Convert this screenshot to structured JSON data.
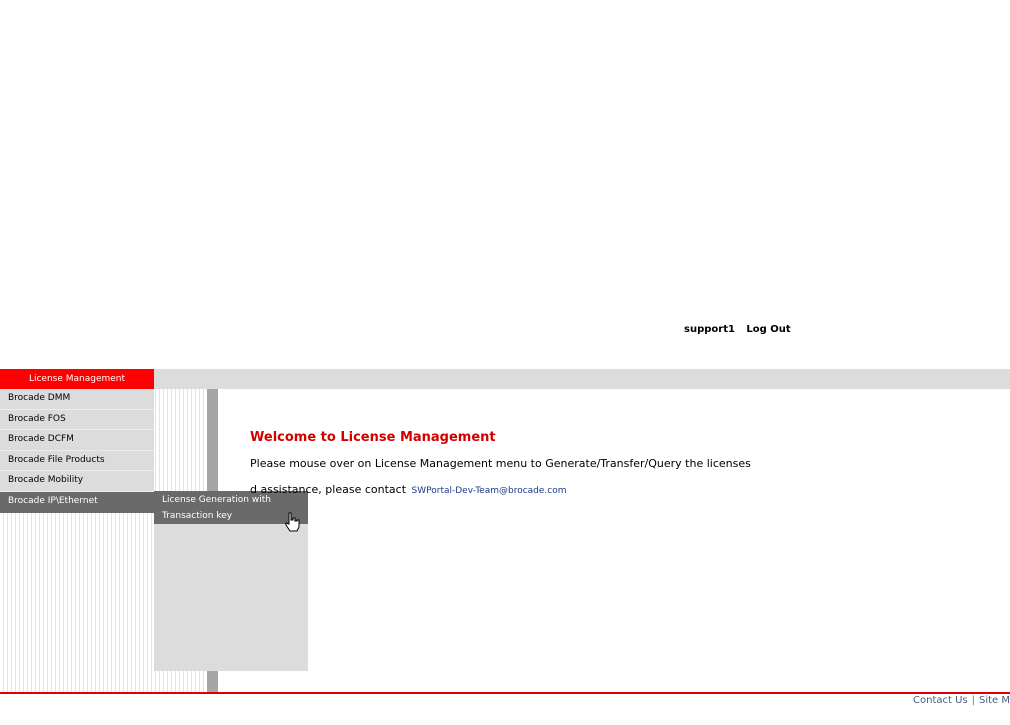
{
  "user_bar": {
    "username": "support1",
    "logout_label": "Log Out"
  },
  "topnav": {
    "active_label": "License Management"
  },
  "menu": {
    "items": [
      {
        "label": "Brocade DMM"
      },
      {
        "label": "Brocade FOS"
      },
      {
        "label": "Brocade DCFM"
      },
      {
        "label": "Brocade File Products"
      },
      {
        "label": "Brocade Mobility"
      },
      {
        "label": "Brocade IP\\Ethernet"
      }
    ]
  },
  "submenu": {
    "line1": "License Generation with",
    "line2": "Transaction key"
  },
  "content": {
    "title": "Welcome to License Management",
    "instruction": "Please mouse over on License Management menu to Generate/Transfer/Query the licenses",
    "help_prefix": "d assistance, please contact",
    "help_email": "SWPortal-Dev-Team@brocade.com"
  },
  "footer": {
    "contact": "Contact Us",
    "sitemap": "Site M"
  },
  "colors": {
    "accent": "#ff0000",
    "nav_bg": "#dcdcdc",
    "active_menu": "#6a6a6a"
  }
}
